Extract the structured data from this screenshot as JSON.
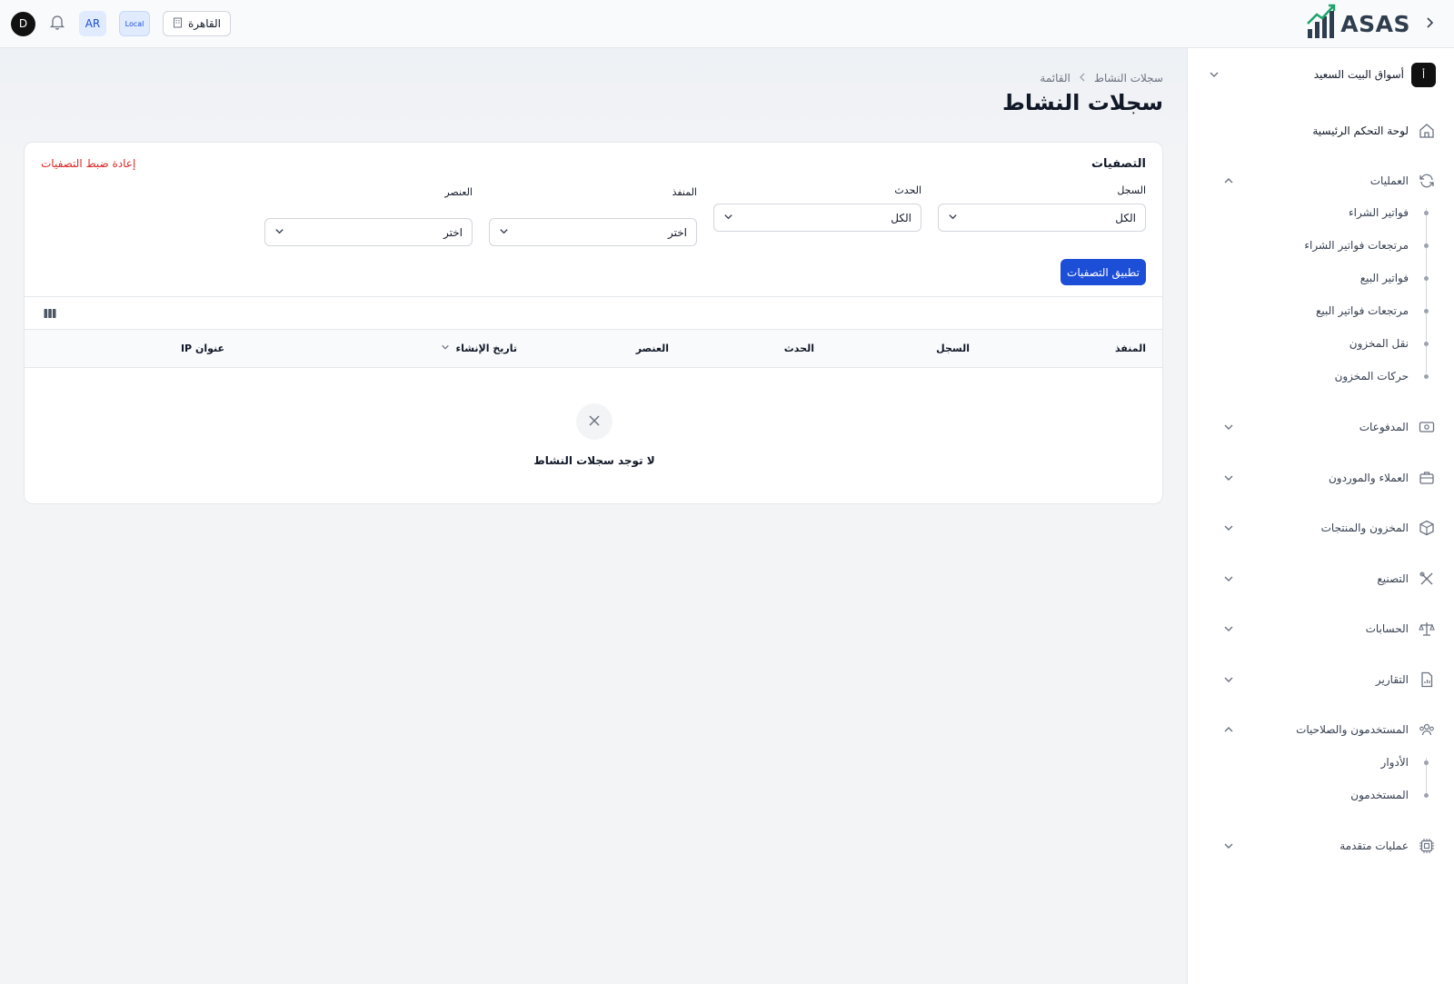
{
  "topbar": {
    "brand": "ASAS",
    "avatar_initial": "D",
    "lang": "AR",
    "env": "Local",
    "branch": "القاهرة"
  },
  "sidebar": {
    "org_badge": "أ",
    "org_name": "أسواق البيت السعيد",
    "items": [
      {
        "label": "لوحة التحكم الرئيسية",
        "icon": "home-icon"
      },
      {
        "label": "العمليات",
        "icon": "refresh-icon",
        "expanded": true,
        "children": [
          "فواتير الشراء",
          "مرتجعات فواتير الشراء",
          "فواتير البيع",
          "مرتجعات فواتير البيع",
          "نقل المخزون",
          "حركات المخزون"
        ]
      },
      {
        "label": "المدفوعات",
        "icon": "payments-icon"
      },
      {
        "label": "العملاء والموردون",
        "icon": "briefcase-icon"
      },
      {
        "label": "المخزون والمنتجات",
        "icon": "box-icon"
      },
      {
        "label": "التصنيع",
        "icon": "tools-icon"
      },
      {
        "label": "الحسابات",
        "icon": "scale-icon"
      },
      {
        "label": "التقارير",
        "icon": "report-icon"
      },
      {
        "label": "المستخدمون والصلاحيات",
        "icon": "users-icon",
        "expanded": true,
        "children": [
          "الأدوار",
          "المستخدمون"
        ]
      },
      {
        "label": "عمليات متقدمة",
        "icon": "chip-icon"
      }
    ]
  },
  "main": {
    "breadcrumb": {
      "parent": "سجلات النشاط",
      "current": "القائمة"
    },
    "title": "سجلات النشاط",
    "filters": {
      "title": "التصفيات",
      "reset": "إعادة ضبط التصفيات",
      "log": {
        "label": "السجل",
        "value": "الكل"
      },
      "event": {
        "label": "الحدث",
        "value": "الكل"
      },
      "causer": {
        "label": "المنفذ",
        "value": "اختر"
      },
      "subject": {
        "label": "العنصر",
        "value": "اختر"
      },
      "apply": "تطبيق التصفيات"
    },
    "table": {
      "columns": [
        "المنفذ",
        "السجل",
        "الحدث",
        "العنصر",
        "تاريخ الإنشاء",
        "عنوان IP"
      ],
      "rows": []
    },
    "empty_text": "لا توجد سجلات النشاط"
  },
  "colors": {
    "accent": "#1d4ed8",
    "danger": "#dc2626"
  }
}
